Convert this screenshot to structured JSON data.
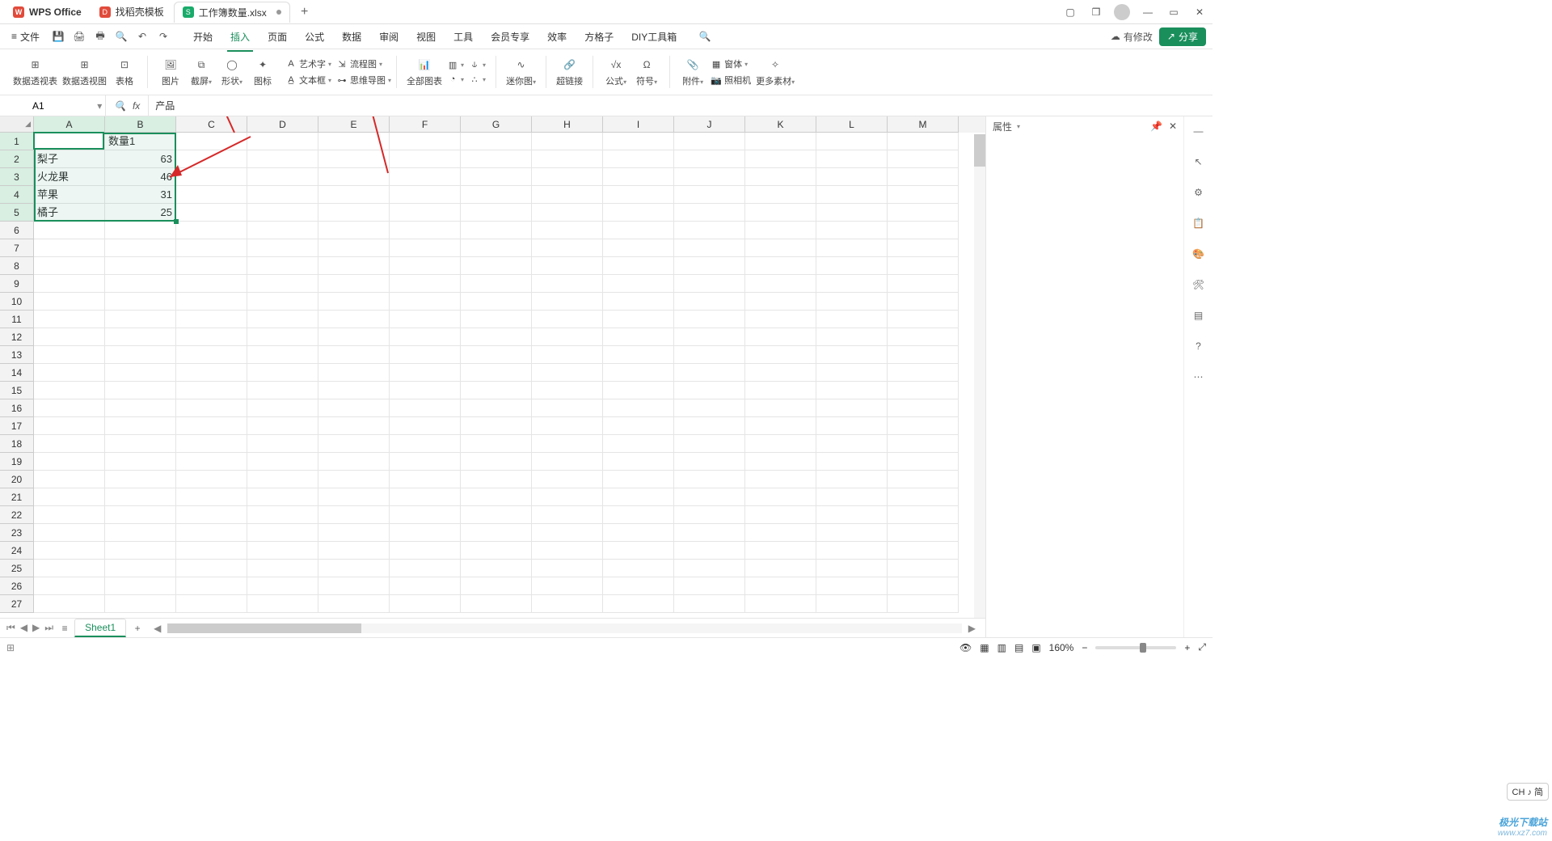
{
  "titlebar": {
    "app_name": "WPS Office",
    "tabs": [
      {
        "icon_color": "#e14b3b",
        "icon_text": "D",
        "label": "找稻壳模板"
      },
      {
        "icon_color": "#1aab6b",
        "icon_text": "S",
        "label": "工作簿数量.xlsx",
        "modified": true,
        "active": true
      }
    ],
    "window_controls": [
      "square",
      "cube",
      "avatar",
      "min",
      "max",
      "close"
    ]
  },
  "menubar": {
    "file": "文件",
    "tabs": [
      "开始",
      "插入",
      "页面",
      "公式",
      "数据",
      "审阅",
      "视图",
      "工具",
      "会员专享",
      "效率",
      "方格子",
      "DIY工具箱"
    ],
    "active_index": 1,
    "modify_label": "有修改",
    "share_label": "分享"
  },
  "ribbon": {
    "g1": {
      "pivot_table": "数据透视表",
      "pivot_chart": "数据透视图",
      "table": "表格"
    },
    "g2": {
      "picture": "图片",
      "screenshot": "截屏",
      "shapes": "形状",
      "icons": "图标"
    },
    "g3": {
      "wordart": "艺术字",
      "textbox": "文本框",
      "flowchart": "流程图",
      "mindmap": "思维导图"
    },
    "g4": {
      "allcharts": "全部图表",
      "chart_bar": "",
      "chart_col": "",
      "chart_line": "",
      "chart_pie": "",
      "chart_other": ""
    },
    "g5": {
      "sparkline": "迷你图"
    },
    "g6": {
      "hyperlink": "超链接"
    },
    "g7": {
      "formula": "公式",
      "symbol": "符号"
    },
    "g8": {
      "attachment": "附件",
      "form": "窗体",
      "camera": "照相机",
      "more": "更多素材"
    }
  },
  "namebox": {
    "value": "A1"
  },
  "formula_bar_value": "产品",
  "grid": {
    "columns": [
      "A",
      "B",
      "C",
      "D",
      "E",
      "F",
      "G",
      "H",
      "I",
      "J",
      "K",
      "L",
      "M"
    ],
    "rows": 27,
    "selection": {
      "r1": 1,
      "c1": 1,
      "r2": 5,
      "c2": 2
    },
    "data": [
      [
        "产品",
        "数量1"
      ],
      [
        "梨子",
        "63"
      ],
      [
        "火龙果",
        "46"
      ],
      [
        "苹果",
        "31"
      ],
      [
        "橘子",
        "25"
      ]
    ]
  },
  "sidepanel": {
    "title": "属性"
  },
  "sheet_tabs": {
    "sheets": [
      "Sheet1"
    ],
    "active": 0
  },
  "statusbar": {
    "zoom": "160%",
    "ime": "CH ♪ 简"
  },
  "watermark": {
    "line1": "极光下载站",
    "line2": "www.xz7.com"
  },
  "chart_data": null
}
